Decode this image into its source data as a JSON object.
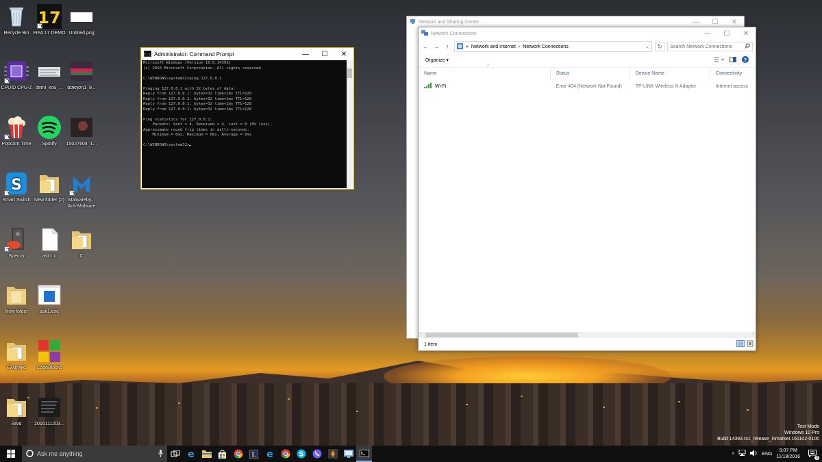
{
  "desktop": {
    "icons": [
      {
        "label": "Recycle Bin"
      },
      {
        "label": "FIFA 17 DEMO"
      },
      {
        "label": "Untitled.png"
      },
      {
        "label": "CPUID CPU-Z"
      },
      {
        "label": "demi_kou_..."
      },
      {
        "label": "άσκηση1_9..."
      },
      {
        "label": "Popcorn Time"
      },
      {
        "label": "Spotify"
      },
      {
        "label": "15027604_1..."
      },
      {
        "label": "Smart Switch"
      },
      {
        "label": "New folder (2)"
      },
      {
        "label": "Malwareby... Anti-Malware"
      },
      {
        "label": "Speccy"
      },
      {
        "label": "ask1.c"
      },
      {
        "label": "C"
      },
      {
        "label": "New folder"
      },
      {
        "label": "ask1.exe"
      },
      {
        "label": "Ελληνικά"
      },
      {
        "label": "CodeBlocks"
      },
      {
        "label": "Ξενα"
      },
      {
        "label": "2016111203..."
      }
    ],
    "watermark": {
      "line1": "Test Mode",
      "line2": "Windows 10 Pro",
      "line3": "Build 14393.rs1_release_inmarket.161102-0100"
    }
  },
  "cmd": {
    "title": "Administrator: Command Prompt",
    "lines": [
      "Microsoft Windows [Version 10.0.14393]",
      "(c) 2016 Microsoft Corporation. All rights reserved.",
      "",
      "C:\\WINDOWS\\system32>ping 127.0.0.1",
      "",
      "Pinging 127.0.0.1 with 32 bytes of data:",
      "Reply from 127.0.0.1: bytes=32 time<1ms TTL=128",
      "Reply from 127.0.0.1: bytes=32 time<1ms TTL=128",
      "Reply from 127.0.0.1: bytes=32 time<1ms TTL=128",
      "Reply from 127.0.0.1: bytes=32 time<1ms TTL=128",
      "",
      "Ping statistics for 127.0.0.1:",
      "    Packets: Sent = 4, Received = 4, Lost = 0 (0% loss),",
      "Approximate round trip times in milli-seconds:",
      "    Minimum = 0ms, Maximum = 0ms, Average = 0ms",
      "",
      "C:\\WINDOWS\\system32>"
    ]
  },
  "nsc": {
    "title": "Network and Sharing Center"
  },
  "nc": {
    "title": "Network Connections",
    "breadcrumb": {
      "prefix": "«",
      "items": [
        "Network and Internet",
        "Network Connections"
      ],
      "separator": "›"
    },
    "search_placeholder": "Search Network Connections",
    "organize_label": "Organize ▾",
    "columns": [
      "Name",
      "Status",
      "Device Name",
      "Connectivity"
    ],
    "rows": [
      {
        "name": "Wi-Fi",
        "status": "Error 404 (Network Not Found)",
        "device": "TP-LINK Wireless N Adapter",
        "connectivity": "Internet access"
      }
    ],
    "status_text": "1 item"
  },
  "taskbar": {
    "search_placeholder": "Ask me anything",
    "language": "ENG",
    "time": "9:07 PM",
    "date": "11/18/2016",
    "notification_count": "3"
  },
  "colors": {
    "cmd_border": "#e0b400",
    "taskbar": "#101010",
    "accent": "#1c5fb0"
  }
}
